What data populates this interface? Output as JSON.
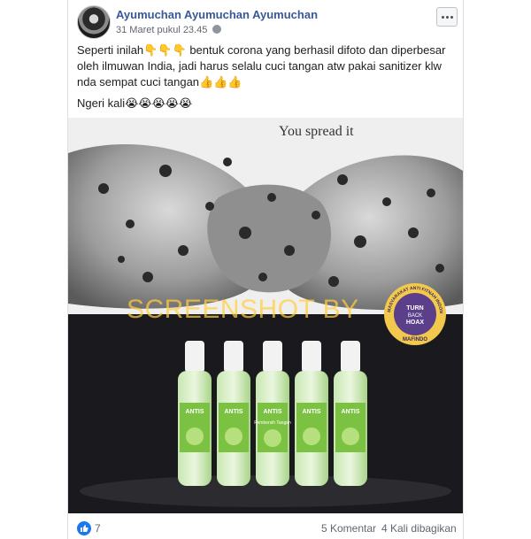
{
  "post": {
    "author": "Ayumuchan Ayumuchan Ayumuchan",
    "timestamp": "31 Maret pukul 23.45",
    "audience_icon": "globe-icon",
    "more_icon": "more-options-icon",
    "text_paragraph_1": "Seperti inilah👇👇👇 bentuk corona yang berhasil difoto dan diperbesar oleh ilmuwan India, jadi harus selalu cuci tangan atw pakai sanitizer klw nda sempat cuci tangan👍👍👍",
    "text_paragraph_2": "Ngeri kali😭😭😭😭😭"
  },
  "media": {
    "top_image_caption": "You spread it",
    "watermark": "SCREENSHOT BY",
    "badge": {
      "top_text": "MASYARAKAT ANTI FITNAH INDONESIA",
      "line1": "TURN",
      "line2": "BACK",
      "line3": "HOAX",
      "bottom_text": "MAFINDO"
    },
    "bottle_brand": "ANTIS",
    "bottle_label": "Pembersih Tangan"
  },
  "footer": {
    "like_count": "7",
    "comments": "5 Komentar",
    "shares": "4 Kali dibagikan"
  },
  "colors": {
    "author_link": "#385898",
    "like_blue": "#1877f2",
    "watermark": "#ffcd3c",
    "badge_gold": "#f2c94c",
    "badge_purple": "#5b3f8a",
    "bottle_green": "#7cc242"
  }
}
